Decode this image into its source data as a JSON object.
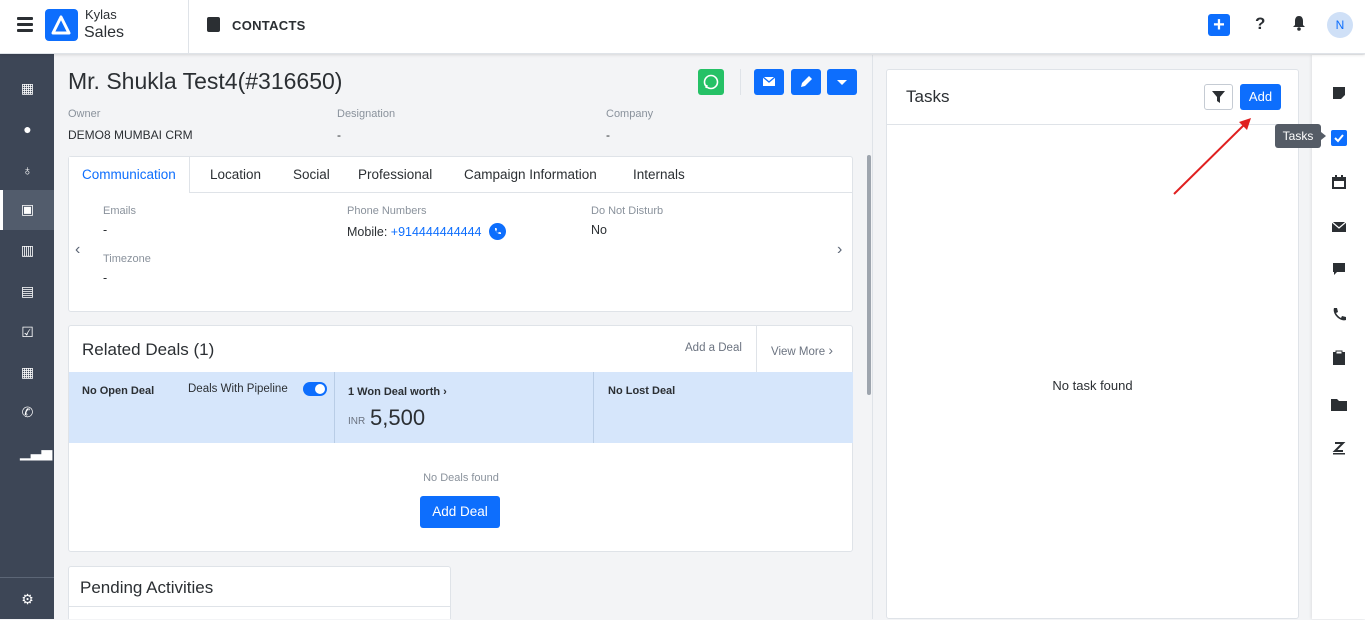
{
  "topbar": {
    "brand_top": "Kylas",
    "brand_bottom": "Sales",
    "section_title": "CONTACTS",
    "avatar_initial": "N"
  },
  "contact": {
    "title": "Mr. Shukla Test4(#316650)",
    "owner_label": "Owner",
    "owner_value": "DEMO8 MUMBAI CRM",
    "designation_label": "Designation",
    "designation_value": "-",
    "company_label": "Company",
    "company_value": "-"
  },
  "tabs": [
    "Communication",
    "Location",
    "Social",
    "Professional",
    "Campaign Information",
    "Internals"
  ],
  "communication": {
    "emails_label": "Emails",
    "emails_value": "-",
    "phone_label": "Phone Numbers",
    "phone_prefix": "Mobile:",
    "phone_value": "+914444444444",
    "dnd_label": "Do Not Disturb",
    "dnd_value": "No",
    "timezone_label": "Timezone",
    "timezone_value": "-"
  },
  "deals": {
    "heading": "Related Deals (1)",
    "add_link": "Add a Deal",
    "view_more": "View More",
    "no_open": "No Open Deal",
    "pipeline_toggle_label": "Deals With Pipeline",
    "won_label": "1 Won Deal worth",
    "won_currency": "INR",
    "won_amount": "5,500",
    "no_lost": "No Lost Deal",
    "empty_text": "No Deals found",
    "add_button": "Add Deal"
  },
  "pending": {
    "heading": "Pending Activities"
  },
  "tasks": {
    "title": "Tasks",
    "add_button": "Add",
    "empty_text": "No task found",
    "tooltip": "Tasks"
  },
  "colors": {
    "accent": "#0d6efd",
    "whatsapp": "#25c166",
    "sidebar": "#3d4656",
    "deal_band": "#d6e6fb",
    "annotation_arrow": "#e02020"
  }
}
